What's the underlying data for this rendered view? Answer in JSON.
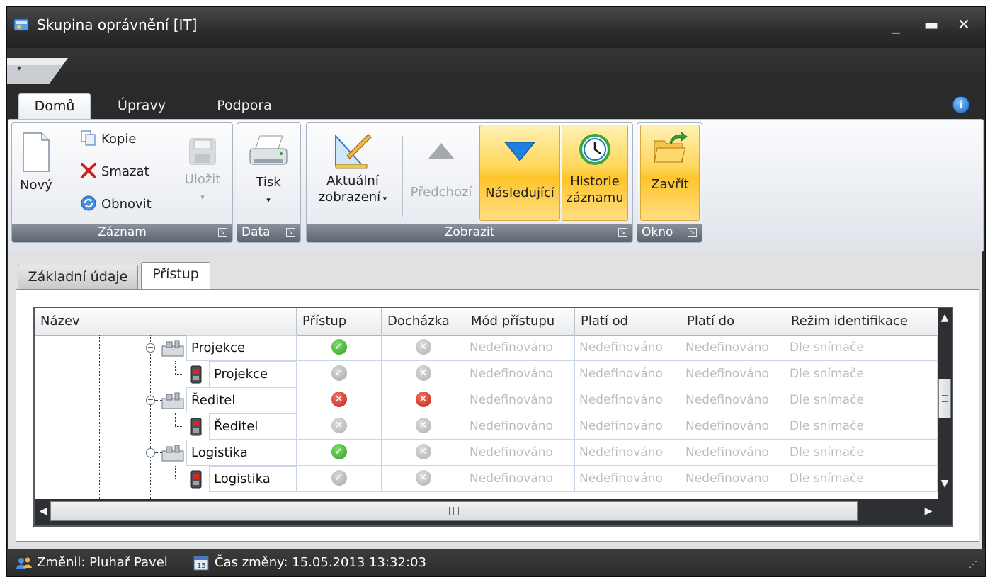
{
  "window": {
    "title": "Skupina oprávnění [IT]"
  },
  "ribbon": {
    "tabs": [
      {
        "label": "Domů",
        "active": true
      },
      {
        "label": "Úpravy",
        "active": false
      },
      {
        "label": "Podpora",
        "active": false
      }
    ],
    "groups": {
      "zaznam": {
        "label": "Záznam",
        "novy": "Nový",
        "kopie": "Kopie",
        "smazat": "Smazat",
        "obnovit": "Obnovit",
        "ulozit": "Uložit"
      },
      "data": {
        "label": "Data",
        "tisk": "Tisk"
      },
      "zobrazit": {
        "label": "Zobrazit",
        "aktualni_line1": "Aktuální",
        "aktualni_line2": "zobrazení",
        "predchozi": "Předchozí",
        "nasledujici": "Následující",
        "historie_line1": "Historie",
        "historie_line2": "záznamu"
      },
      "okno": {
        "label": "Okno",
        "zavrit": "Zavřít"
      }
    }
  },
  "content_tabs": [
    {
      "label": "Základní údaje",
      "active": false
    },
    {
      "label": "Přístup",
      "active": true
    }
  ],
  "grid": {
    "columns": [
      "Název",
      "Přístup",
      "Docházka",
      "Mód přístupu",
      "Platí od",
      "Platí do",
      "Režim identifikace"
    ],
    "rows": [
      {
        "name": "Projekce",
        "kind": "group",
        "pristup": "ok",
        "dochazka": "nod",
        "mod": "Nedefinováno",
        "od": "Nedefinováno",
        "do": "Nedefinováno",
        "rezim": "Dle snímače"
      },
      {
        "name": "Projekce",
        "kind": "reader",
        "pristup": "okd",
        "dochazka": "nod",
        "mod": "Nedefinováno",
        "od": "Nedefinováno",
        "do": "Nedefinováno",
        "rezim": "Dle snímače"
      },
      {
        "name": "Ředitel",
        "kind": "group",
        "pristup": "no",
        "dochazka": "no",
        "mod": "Nedefinováno",
        "od": "Nedefinováno",
        "do": "Nedefinováno",
        "rezim": "Dle snímače"
      },
      {
        "name": "Ředitel",
        "kind": "reader",
        "pristup": "nod",
        "dochazka": "nod",
        "mod": "Nedefinováno",
        "od": "Nedefinováno",
        "do": "Nedefinováno",
        "rezim": "Dle snímače"
      },
      {
        "name": "Logistika",
        "kind": "group",
        "pristup": "ok",
        "dochazka": "nod",
        "mod": "Nedefinováno",
        "od": "Nedefinováno",
        "do": "Nedefinováno",
        "rezim": "Dle snímače"
      },
      {
        "name": "Logistika",
        "kind": "reader",
        "pristup": "okd",
        "dochazka": "nod",
        "mod": "Nedefinováno",
        "od": "Nedefinováno",
        "do": "Nedefinováno",
        "rezim": "Dle snímače"
      }
    ]
  },
  "status": {
    "changed_by": "Změnil: Pluhař Pavel",
    "changed_at": "Čas změny: 15.05.2013 13:32:03"
  },
  "colors": {
    "highlight": "#ffd659",
    "status_ok": "#2f9b22",
    "status_error": "#bf1f12",
    "chrome_dark": "#2a2a2a"
  },
  "icons": [
    "window-icon",
    "minimize-icon",
    "maximize-icon",
    "close-icon",
    "info-icon",
    "new-document-icon",
    "copy-icon",
    "delete-icon",
    "refresh-icon",
    "save-icon",
    "printer-icon",
    "view-settings-icon",
    "arrow-up-icon",
    "arrow-down-icon",
    "history-clock-icon",
    "close-folder-icon",
    "user-icon",
    "calendar-icon"
  ]
}
